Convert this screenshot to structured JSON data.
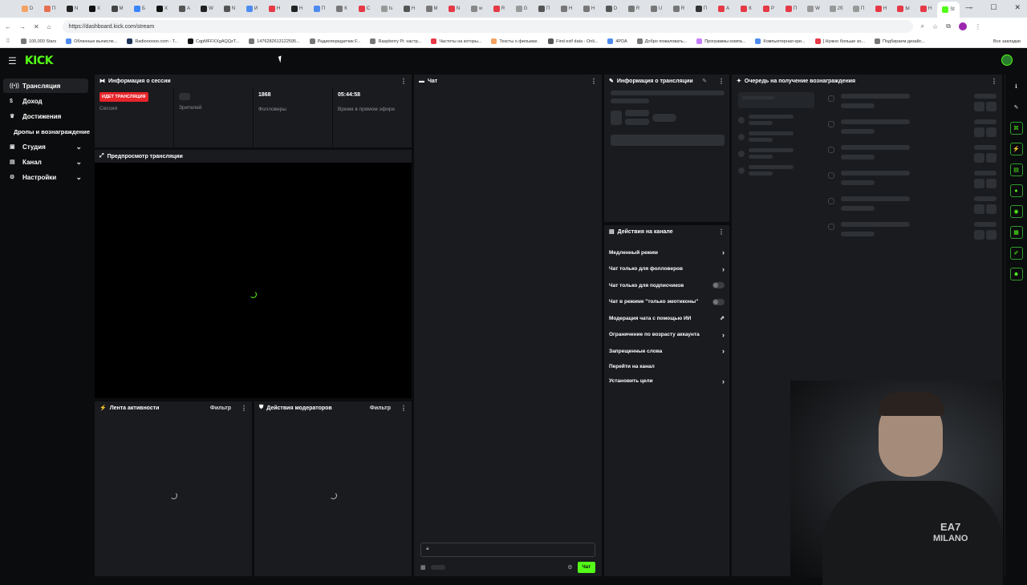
{
  "browser": {
    "url": "https://dashboard.kick.com/stream",
    "tabs": [
      {
        "label": "D",
        "color": "#f4a261"
      },
      {
        "label": "П",
        "color": "#e76f51"
      },
      {
        "label": "N",
        "color": "#222"
      },
      {
        "label": "X",
        "color": "#111"
      },
      {
        "label": "M",
        "color": "#444"
      },
      {
        "label": "Б",
        "color": "#3a86ff"
      },
      {
        "label": "X",
        "color": "#111"
      },
      {
        "label": "A",
        "color": "#555"
      },
      {
        "label": "W",
        "color": "#222"
      },
      {
        "label": "N",
        "color": "#555"
      },
      {
        "label": "И",
        "color": "#4d8bf0"
      },
      {
        "label": "Н",
        "color": "#e63946"
      },
      {
        "label": "Н",
        "color": "#222"
      },
      {
        "label": "П",
        "color": "#4d8bf0"
      },
      {
        "label": "К",
        "color": "#777"
      },
      {
        "label": "С",
        "color": "#e63946"
      },
      {
        "label": "Is",
        "color": "#999"
      },
      {
        "label": "Н",
        "color": "#555"
      },
      {
        "label": "M",
        "color": "#777"
      },
      {
        "label": "N",
        "color": "#e63946"
      },
      {
        "label": "w",
        "color": "#888"
      },
      {
        "label": "R",
        "color": "#e63946"
      },
      {
        "label": "G",
        "color": "#999"
      },
      {
        "label": "П",
        "color": "#555"
      },
      {
        "label": "Н",
        "color": "#777"
      },
      {
        "label": "Н",
        "color": "#777"
      },
      {
        "label": "D",
        "color": "#555"
      },
      {
        "label": "R",
        "color": "#777"
      },
      {
        "label": "U",
        "color": "#777"
      },
      {
        "label": "R",
        "color": "#777"
      },
      {
        "label": "П",
        "color": "#333"
      },
      {
        "label": "A",
        "color": "#e63946"
      },
      {
        "label": "К",
        "color": "#e63946"
      },
      {
        "label": "Р",
        "color": "#e63946"
      },
      {
        "label": "П",
        "color": "#e63946"
      },
      {
        "label": "W",
        "color": "#999"
      },
      {
        "label": "2б",
        "color": "#999"
      },
      {
        "label": "П",
        "color": "#999"
      },
      {
        "label": "Н",
        "color": "#e63946"
      },
      {
        "label": "Ы",
        "color": "#e63946"
      },
      {
        "label": "Н",
        "color": "#e63946"
      },
      {
        "label": "St",
        "color": "#53fc18"
      }
    ],
    "bookmarks": [
      {
        "label": "100,000 Stars",
        "color": "#777"
      },
      {
        "label": "Облачные вычисле...",
        "color": "#4d8bf0"
      },
      {
        "label": "Radioooooo.com - T...",
        "color": "#1d3557"
      },
      {
        "label": "CqpMFFXXgAQQzT...",
        "color": "#111"
      },
      {
        "label": "1476282613122595...",
        "color": "#777"
      },
      {
        "label": "Радиопередатчик F...",
        "color": "#777"
      },
      {
        "label": "Raspberry Pi: настр...",
        "color": "#777"
      },
      {
        "label": "Частоты на которы...",
        "color": "#e63946"
      },
      {
        "label": "Тексты о фильмах.",
        "color": "#f4a261"
      },
      {
        "label": "Find exif data - Onli...",
        "color": "#555"
      },
      {
        "label": "4PDA",
        "color": "#4d8bf0"
      },
      {
        "label": "Добро пожаловать...",
        "color": "#777"
      },
      {
        "label": "Программы компа...",
        "color": "#c77dff"
      },
      {
        "label": "Компьютерная кри...",
        "color": "#4d8bf0"
      },
      {
        "label": "[ Нужно больше зо...",
        "color": "#e63946"
      },
      {
        "label": "Подбираем дизайс...",
        "color": "#777"
      }
    ],
    "all_bookmarks": "Все закладки"
  },
  "app": {
    "logo": "KICK"
  },
  "sidebar": {
    "items": [
      {
        "label": "Трансляция",
        "icon": "broadcast-icon",
        "active": true
      },
      {
        "label": "Доход",
        "icon": "dollar-icon"
      },
      {
        "label": "Достижения",
        "icon": "trophy-icon"
      }
    ],
    "sub_item": "Дропы и вознаграждение",
    "expandable": [
      {
        "label": "Студия",
        "icon": "studio-icon"
      },
      {
        "label": "Канал",
        "icon": "channel-icon"
      },
      {
        "label": "Настройки",
        "icon": "gear-icon"
      }
    ]
  },
  "session": {
    "title": "Информация о сессии",
    "live_badge": "ИДЕТ ТРАНСЛЯЦИЯ",
    "session_label": "Сессия",
    "viewers_label": "Зрителей",
    "followers_value": "1868",
    "followers_label": "Фолловеры",
    "uptime_value": "05:44:58",
    "uptime_label": "Время в прямом эфире"
  },
  "preview": {
    "title": "Предпросмотр трансляции"
  },
  "activity": {
    "title": "Лента активности",
    "filter": "Фильтр"
  },
  "modactions": {
    "title": "Действия модераторов",
    "filter": "Фильтр"
  },
  "chat": {
    "title": "Чат",
    "send": "Чат"
  },
  "streaminfo": {
    "title": "Информация о трансляции"
  },
  "rewards": {
    "title": "Очередь на получение вознаграждения"
  },
  "channel_actions": {
    "title": "Действия на канале",
    "items": [
      {
        "label": "Медленный режим",
        "control": "chevron"
      },
      {
        "label": "Чат только для фолловеров",
        "control": "chevron"
      },
      {
        "label": "Чат только для подписчиков",
        "control": "toggle"
      },
      {
        "label": "Чат в режиме \"только эмотиконы\"",
        "control": "toggle"
      },
      {
        "label": "Модерация чата с помощью ИИ",
        "control": "external"
      },
      {
        "label": "Ограничение по возрасту аккаунта",
        "control": "chevron"
      },
      {
        "label": "Запрещенные слова",
        "control": "chevron"
      },
      {
        "label": "Перейти на канал",
        "control": "none"
      },
      {
        "label": "Установить цели",
        "control": "chevron"
      }
    ]
  },
  "webcam": {
    "shirt_text_1": "EA7",
    "shirt_text_2": "MILANO"
  }
}
